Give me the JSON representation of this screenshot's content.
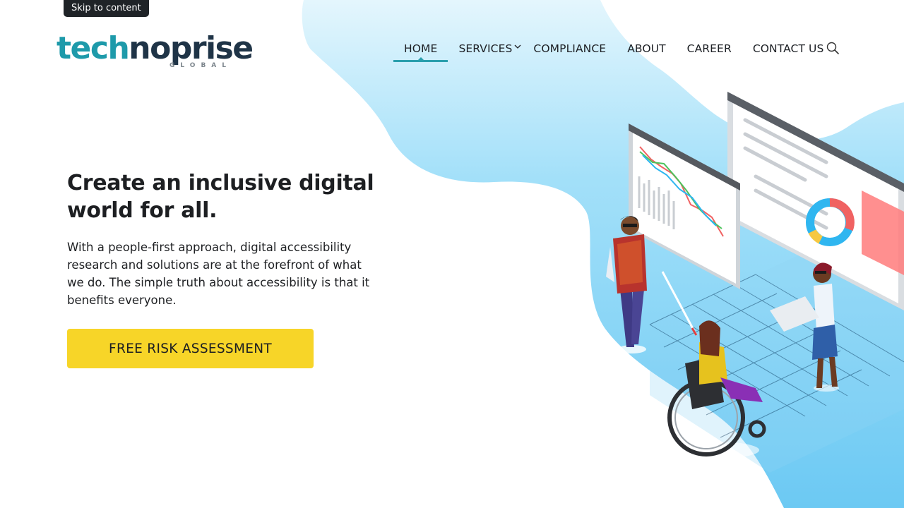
{
  "skip_link": "Skip to content",
  "logo": {
    "brand_a": "tech",
    "brand_b": "noprise",
    "sub": "GLOBAL"
  },
  "nav": {
    "home": "HOME",
    "services": "SERVICES",
    "compliance": "COMPLIANCE",
    "about": "ABOUT",
    "career": "CAREER",
    "contact": "CONTACT US"
  },
  "hero": {
    "title": "Create an inclusive digital world for all.",
    "text": "With a people-first approach, digital accessibility research and solutions are at the forefront of what we do. The simple truth about accessibility is that it benefits everyone.",
    "cta": "FREE RISK ASSESSMENT"
  },
  "icons": {
    "search": "search-icon",
    "caret": "chevron-down-icon"
  },
  "colors": {
    "accent": "#2a9fad",
    "cta": "#f7d528",
    "brand_teal": "#1e9aaa",
    "brand_dark": "#1f3447",
    "blob": "#7fd1f5"
  }
}
